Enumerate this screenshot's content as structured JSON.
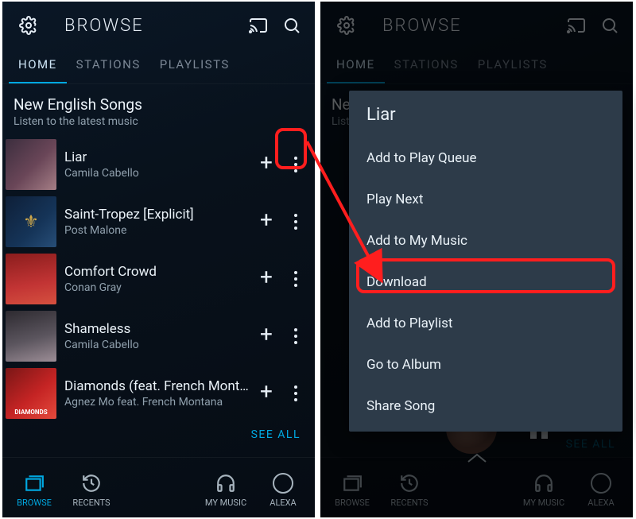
{
  "app_title": "BROWSE",
  "tabs": {
    "home": "HOME",
    "stations": "STATIONS",
    "playlists": "PLAYLISTS"
  },
  "section": {
    "title": "New English Songs",
    "subtitle": "Listen to the latest music"
  },
  "songs": [
    {
      "title": "Liar",
      "artist": "Camila Cabello"
    },
    {
      "title": "Saint-Tropez [Explicit]",
      "artist": "Post Malone"
    },
    {
      "title": "Comfort Crowd",
      "artist": "Conan Gray"
    },
    {
      "title": "Shameless",
      "artist": "Camila Cabello"
    },
    {
      "title": "Diamonds (feat. French Montana)",
      "artist": "Agnez Mo feat. French Montana"
    }
  ],
  "see_all": "SEE ALL",
  "bottom": {
    "browse": "BROWSE",
    "recents": "RECENTS",
    "mymusic": "MY MUSIC",
    "alexa": "ALEXA"
  },
  "menu": {
    "title": "Liar",
    "items": {
      "queue": "Add to Play Queue",
      "play_next": "Play Next",
      "my_music": "Add to My Music",
      "download": "Download",
      "playlist": "Add to Playlist",
      "album": "Go to Album",
      "share": "Share Song"
    }
  },
  "colors": {
    "accent": "#00a8e1",
    "callout": "#ff1e1e"
  }
}
